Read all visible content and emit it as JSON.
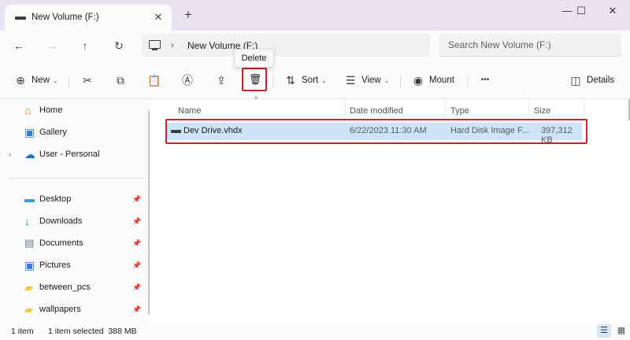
{
  "window": {
    "tab_title": "New Volume (F:)",
    "tab_close": "✕",
    "new_tab": "+",
    "controls": {
      "minimize": "—",
      "maximize": "☐",
      "close": "✕"
    }
  },
  "nav": {
    "back": "←",
    "forward": "→",
    "up": "↑",
    "refresh": "↻",
    "breadcrumb_sep": "›",
    "path": "New Volume (F:)",
    "search_placeholder": "Search New Volume (F:)"
  },
  "tooltip": {
    "text": "Delete"
  },
  "toolbar": {
    "new_label": "New",
    "new_icon": "⊕",
    "cut_icon": "✂",
    "copy_icon": "⧉",
    "paste_icon": "📋",
    "rename_icon": "Ⓐ",
    "share_icon": "⇪",
    "delete_icon": "🗑",
    "sort_icon": "⇅",
    "sort_label": "Sort",
    "view_icon": "☰",
    "view_label": "View",
    "mount_icon": "◉",
    "mount_label": "Mount",
    "more_icon": "•••",
    "details_icon": "◫",
    "details_label": "Details",
    "chevron": "⌄",
    "sort_caret": "^"
  },
  "sidebar": {
    "items": [
      {
        "label": "Home",
        "icon": "⌂",
        "color": "#e07a2f"
      },
      {
        "label": "Gallery",
        "icon": "▣",
        "color": "#3a7bd5"
      },
      {
        "label": "User - Personal",
        "icon": "☁",
        "color": "#1a73c8",
        "expand": "›"
      },
      {
        "label": "Desktop",
        "icon": "▬",
        "color": "#3a9ad9",
        "pin": "📌"
      },
      {
        "label": "Downloads",
        "icon": "↓",
        "color": "#2aa36b",
        "pin": "📌"
      },
      {
        "label": "Documents",
        "icon": "▤",
        "color": "#6b7a8a",
        "pin": "📌"
      },
      {
        "label": "Pictures",
        "icon": "▣",
        "color": "#3a7bd5",
        "pin": "📌"
      },
      {
        "label": "between_pcs",
        "icon": "▰",
        "color": "#f2c744",
        "pin": "📌"
      },
      {
        "label": "wallpapers",
        "icon": "▰",
        "color": "#f2c744",
        "pin": "📌"
      }
    ]
  },
  "columns": {
    "name": "Name",
    "date": "Date modified",
    "type": "Type",
    "size": "Size"
  },
  "files": [
    {
      "name": "Dev Drive.vhdx",
      "date": "6/22/2023 11:30 AM",
      "type": "Hard Disk Image F...",
      "size": "397,312 KB"
    }
  ],
  "status": {
    "count": "1 item",
    "selected": "1 item selected  388 MB",
    "view_details_icon": "☰",
    "view_tiles_icon": "▦"
  },
  "colors": {
    "highlight_red": "#c0262d",
    "selection_blue": "#cce4f7",
    "titlebar": "#e8e3ee"
  }
}
